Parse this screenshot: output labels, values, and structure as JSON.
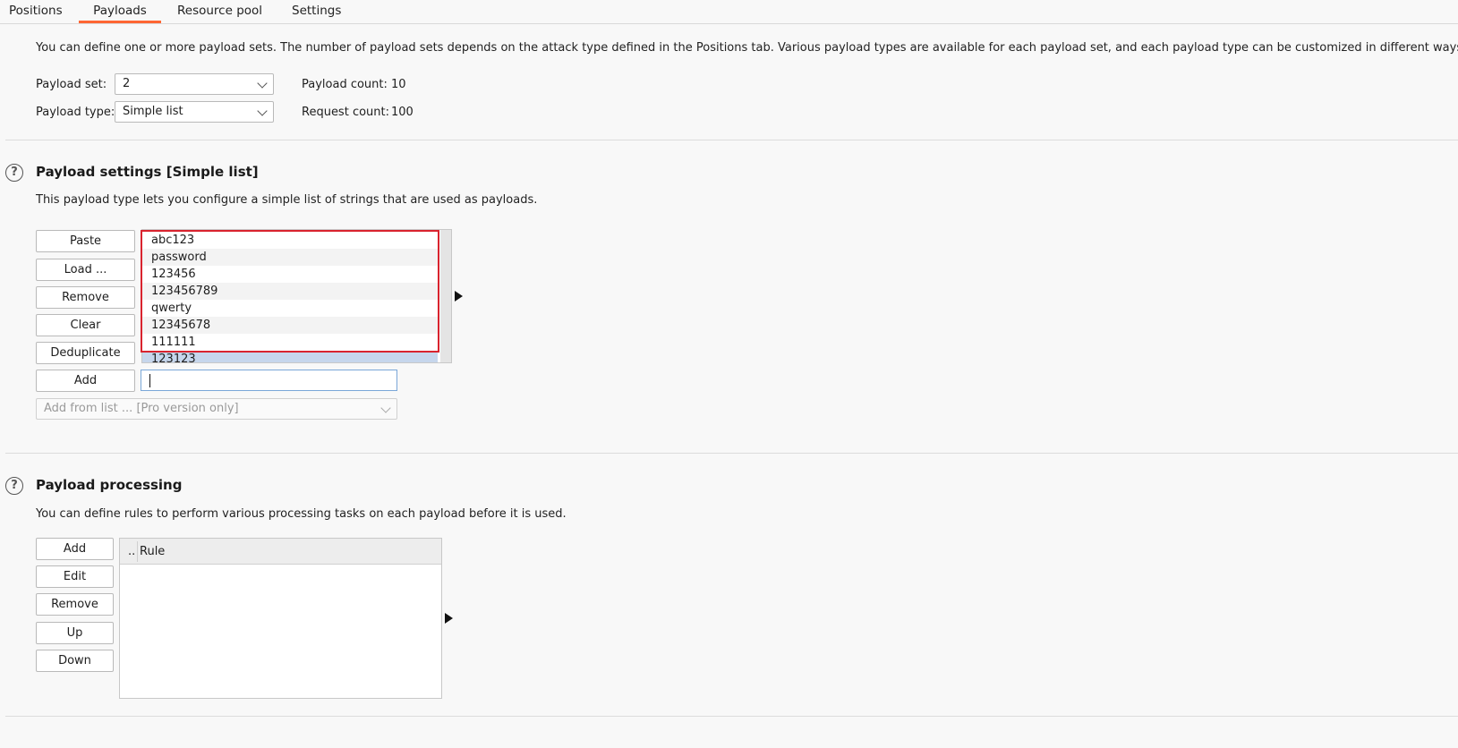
{
  "tabs": [
    {
      "label": "Positions"
    },
    {
      "label": "Payloads"
    },
    {
      "label": "Resource pool"
    },
    {
      "label": "Settings"
    }
  ],
  "payload_sets": {
    "description": "You can define one or more payload sets. The number of payload sets depends on the attack type defined in the Positions tab. Various payload types are available for each payload set, and each payload type can be customized in different ways.",
    "set_label": "Payload set:",
    "set_value": "2",
    "type_label": "Payload type:",
    "type_value": "Simple list",
    "count_label": "Payload count:",
    "count_value": "10",
    "request_label": "Request count:",
    "request_value": "100"
  },
  "payload_settings": {
    "help": "?",
    "title": "Payload settings [Simple list]",
    "description": "This payload type lets you configure a simple list of strings that are used as payloads.",
    "buttons": {
      "paste": "Paste",
      "load": "Load ...",
      "remove": "Remove",
      "clear": "Clear",
      "deduplicate": "Deduplicate",
      "add": "Add"
    },
    "items": [
      "abc123",
      "password",
      "123456",
      "123456789",
      "qwerty",
      "12345678",
      "111111",
      "123123"
    ],
    "add_input_value": "",
    "add_from_list": "Add from list ... [Pro version only]"
  },
  "payload_processing": {
    "help": "?",
    "title": "Payload processing",
    "description": "You can define rules to perform various processing tasks on each payload before it is used.",
    "buttons": {
      "add": "Add",
      "edit": "Edit",
      "remove": "Remove",
      "up": "Up",
      "down": "Down"
    },
    "columns": [
      "..",
      "Rule"
    ]
  },
  "colors": {
    "active_tab_accent": "#ff6633",
    "highlight_box": "#d9232e",
    "selected_row": "#c6d6ec"
  }
}
